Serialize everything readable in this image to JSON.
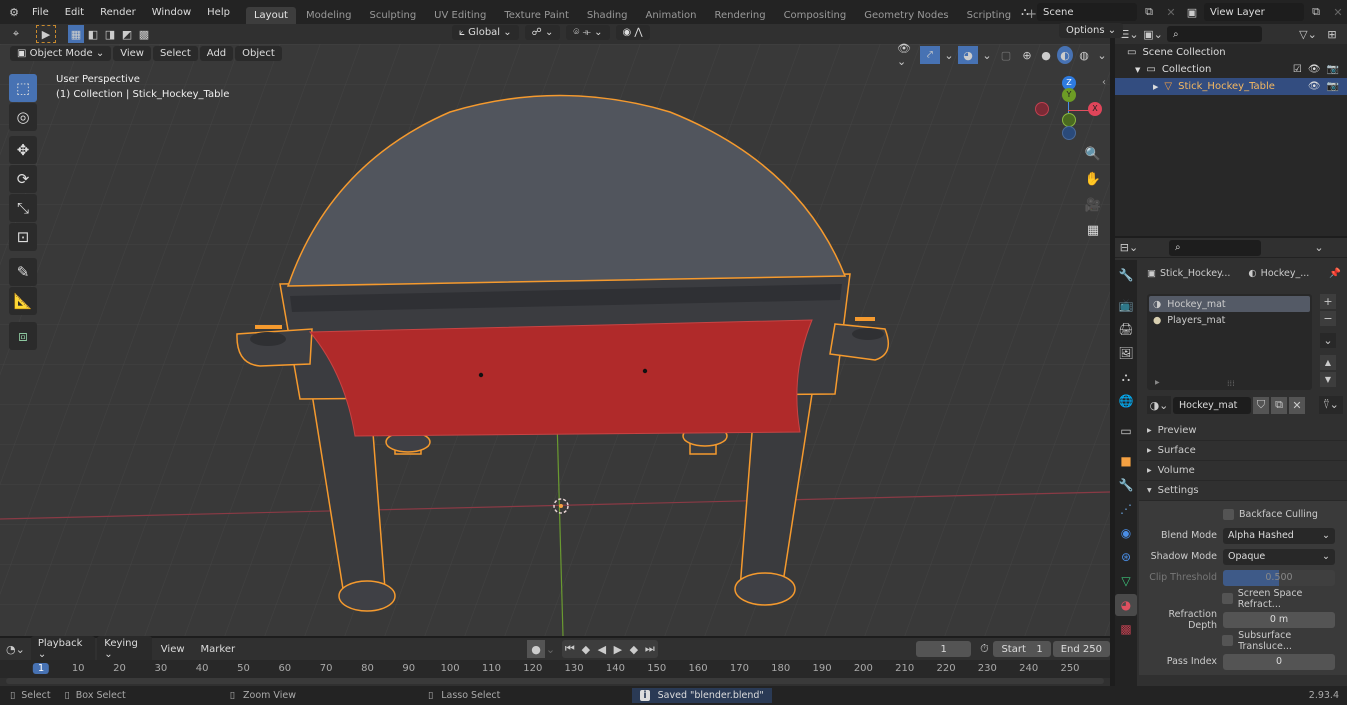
{
  "topbar": {
    "menus": [
      "File",
      "Edit",
      "Render",
      "Window",
      "Help"
    ],
    "workspace_tabs": [
      "Layout",
      "Modeling",
      "Sculpting",
      "UV Editing",
      "Texture Paint",
      "Shading",
      "Animation",
      "Rendering",
      "Compositing",
      "Geometry Nodes",
      "Scripting"
    ],
    "active_tab": "Layout",
    "add_tab": "+",
    "scene": "Scene",
    "view_layer": "View Layer"
  },
  "viewport_header": {
    "mode": "Object Mode",
    "menus": [
      "View",
      "Select",
      "Add",
      "Object"
    ],
    "transform_orientation": "Global",
    "options": "Options"
  },
  "viewport": {
    "perspective": "User Perspective",
    "collection_info": "(1) Collection | Stick_Hockey_Table",
    "gizmo_axes": {
      "z": "Z",
      "x": "X",
      "y": "Y"
    },
    "tools": [
      "select-box",
      "cursor",
      "move",
      "rotate",
      "scale",
      "transform",
      "annotate",
      "measure",
      "add-cube"
    ],
    "nav_buttons": [
      "zoom",
      "pan",
      "camera",
      "ortho-grid"
    ]
  },
  "outliner": {
    "search_placeholder": "",
    "rows": [
      {
        "label": "Scene Collection",
        "level": 0
      },
      {
        "label": "Collection",
        "level": 1
      },
      {
        "label": "Stick_Hockey_Table",
        "level": 2,
        "selected": true
      }
    ]
  },
  "properties": {
    "object_name": "Stick_Hockey...",
    "material_short": "Hockey_...",
    "material_slots": [
      "Hockey_mat",
      "Players_mat"
    ],
    "active_material": "Hockey_mat",
    "sections": [
      "Preview",
      "Surface",
      "Volume",
      "Settings"
    ],
    "settings": {
      "backface_culling": "Backface Culling",
      "blend_mode_label": "Blend Mode",
      "blend_mode": "Alpha Hashed",
      "shadow_mode_label": "Shadow Mode",
      "shadow_mode": "Opaque",
      "clip_threshold_label": "Clip Threshold",
      "clip_threshold": "0.500",
      "clip_threshold_fraction": 0.5,
      "ssr": "Screen Space Refract...",
      "refraction_depth_label": "Refraction Depth",
      "refraction_depth": "0 m",
      "subsurface": "Subsurface Transluce...",
      "pass_index_label": "Pass Index",
      "pass_index": "0"
    }
  },
  "timeline": {
    "menus": [
      "Playback",
      "Keying",
      "View",
      "Marker"
    ],
    "current_frame": "1",
    "start_label": "Start",
    "start": "1",
    "end_label": "End",
    "end": "250",
    "ticks": [
      "1",
      "10",
      "20",
      "30",
      "40",
      "50",
      "60",
      "70",
      "80",
      "90",
      "100",
      "110",
      "120",
      "130",
      "140",
      "150",
      "160",
      "170",
      "180",
      "190",
      "200",
      "210",
      "220",
      "230",
      "240",
      "250"
    ]
  },
  "statusbar": {
    "select": "Select",
    "box_select": "Box Select",
    "zoom_view": "Zoom View",
    "lasso_select": "Lasso Select",
    "message": "Saved \"blender.blend\"",
    "version": "2.93.4"
  },
  "colors": {
    "accent": "#4772b3",
    "selection": "#f5a142",
    "object_red": "#b02a2a"
  }
}
